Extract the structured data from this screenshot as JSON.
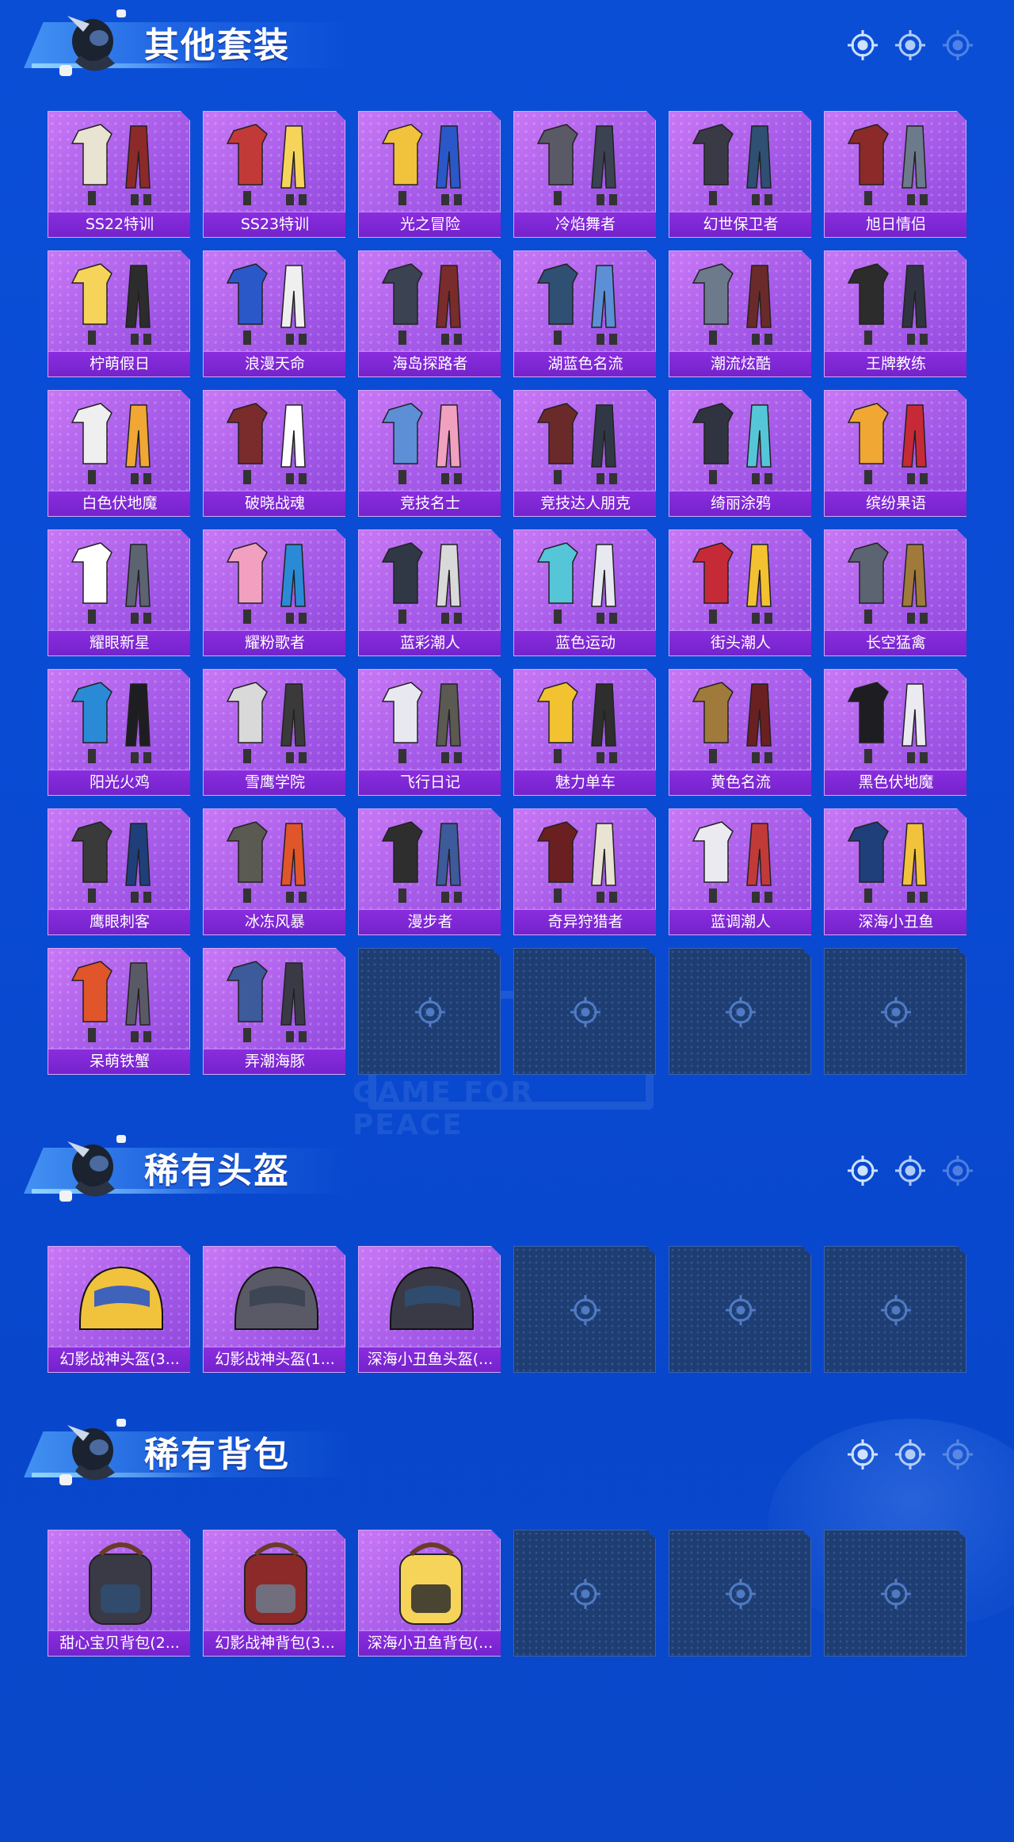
{
  "sections": [
    {
      "title": "其他套装",
      "items": [
        "SS22特训",
        "SS23特训",
        "光之冒险",
        "冷焰舞者",
        "幻世保卫者",
        "旭日情侣",
        "柠萌假日",
        "浪漫天命",
        "海岛探路者",
        "湖蓝色名流",
        "潮流炫酷",
        "王牌教练",
        "白色伏地魔",
        "破晓战魂",
        "竞技名士",
        "竞技达人朋克",
        "绮丽涂鸦",
        "缤纷果语",
        "耀眼新星",
        "耀粉歌者",
        "蓝彩潮人",
        "蓝色运动",
        "街头潮人",
        "长空猛禽",
        "阳光火鸡",
        "雪鹰学院",
        "飞行日记",
        "魅力单车",
        "黄色名流",
        "黑色伏地魔",
        "鹰眼刺客",
        "冰冻风暴",
        "漫步者",
        "奇异狩猎者",
        "蓝调潮人",
        "深海小丑鱼",
        "呆萌铁蟹",
        "弄潮海豚"
      ]
    },
    {
      "title": "稀有头盔",
      "items": [
        "幻影战神头盔(3...",
        "幻影战神头盔(1...",
        "深海小丑鱼头盔(..."
      ]
    },
    {
      "title": "稀有背包",
      "items": [
        "甜心宝贝背包(2...",
        "幻影战神背包(3...",
        "深海小丑鱼背包(..."
      ]
    }
  ],
  "watermark": "GAME FOR PEACE",
  "colors": {
    "background": "#0b4ed6",
    "card": "#a55ae8",
    "label": "#7a26d0",
    "empty": "#1e3d72"
  }
}
